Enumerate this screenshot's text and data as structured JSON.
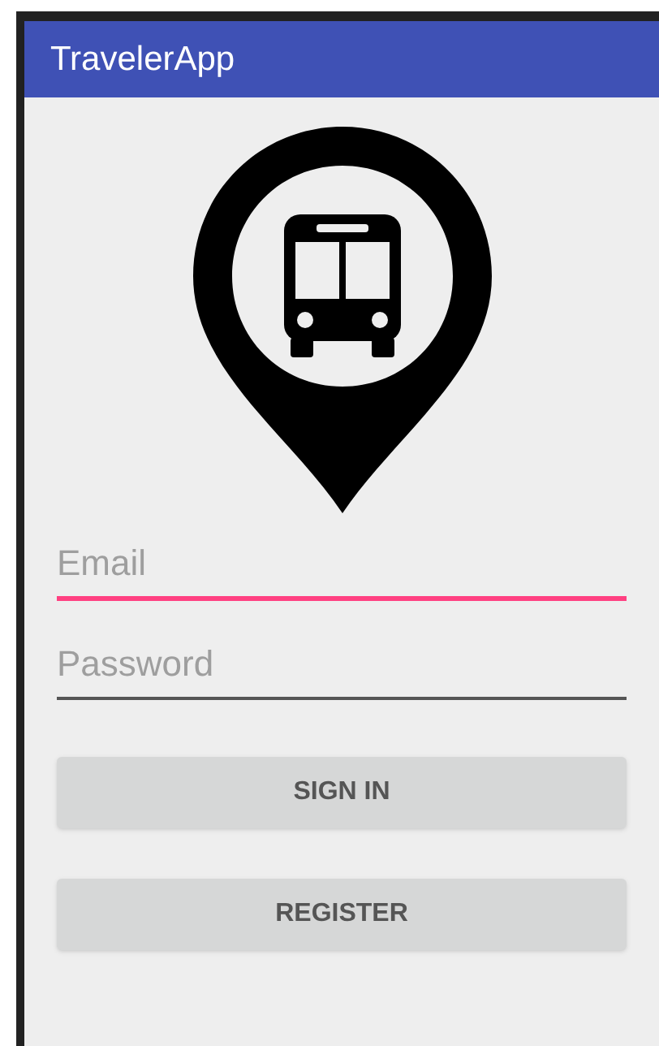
{
  "app_bar": {
    "title": "TravelerApp"
  },
  "fields": [
    {
      "placeholder": "Email",
      "focused": true
    },
    {
      "placeholder": "Password",
      "focused": false
    }
  ],
  "buttons": [
    "SIGN IN",
    "REGISTER"
  ]
}
